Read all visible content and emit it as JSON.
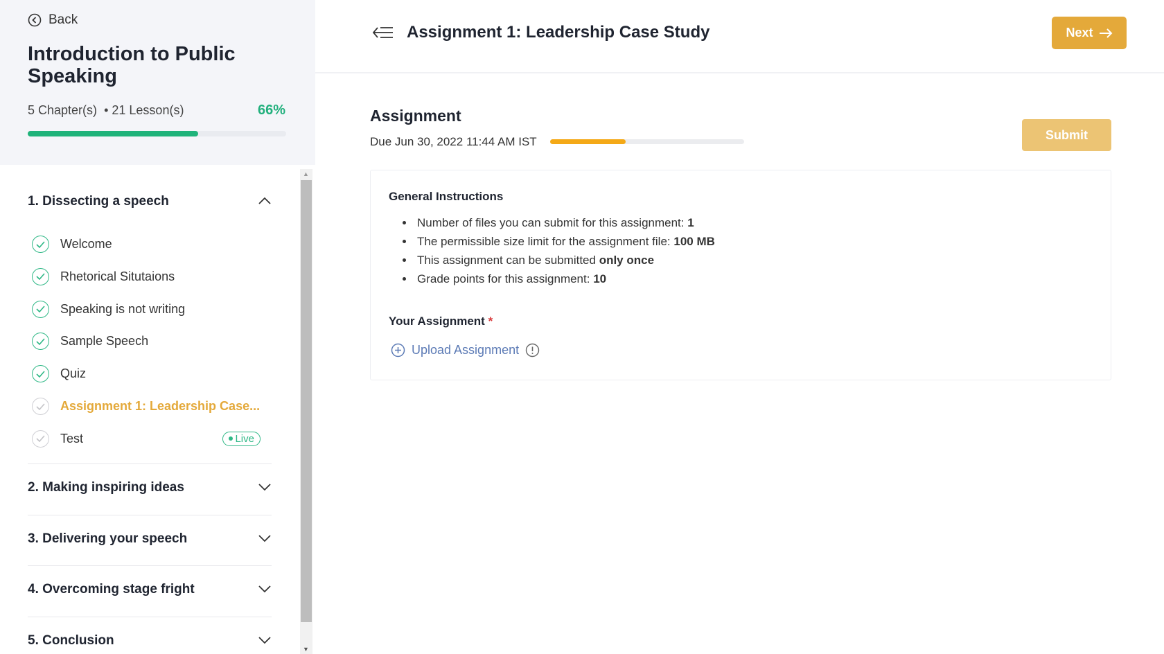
{
  "sidebar": {
    "back_label": "Back",
    "course_title": "Introduction to Public Speaking",
    "chapters_count": "5 Chapter(s)",
    "separator": "•",
    "lessons_count": "21 Lesson(s)",
    "progress_label": "66%",
    "progress_percent": 66,
    "chapters": [
      {
        "title": "1. Dissecting a speech",
        "expanded": true,
        "lessons": [
          {
            "label": "Welcome",
            "completed": true
          },
          {
            "label": "Rhetorical Situtaions",
            "completed": true
          },
          {
            "label": "Speaking is not writing",
            "completed": true
          },
          {
            "label": "Sample Speech",
            "completed": true
          },
          {
            "label": "Quiz",
            "completed": true
          },
          {
            "label": "Assignment 1: Leadership Case...",
            "completed": false,
            "active": true
          },
          {
            "label": "Test",
            "completed": false,
            "badge": "Live"
          }
        ]
      },
      {
        "title": "2. Making inspiring ideas",
        "expanded": false
      },
      {
        "title": "3. Delivering your speech",
        "expanded": false
      },
      {
        "title": "4. Overcoming stage fright",
        "expanded": false
      },
      {
        "title": "5. Conclusion",
        "expanded": false
      }
    ]
  },
  "header": {
    "title": "Assignment 1: Leadership Case Study",
    "next_label": "Next"
  },
  "assignment": {
    "heading": "Assignment",
    "due": "Due Jun 30, 2022 11:44 AM IST",
    "time_progress_percent": 39,
    "submit_label": "Submit",
    "instructions_title": "General Instructions",
    "instructions": [
      {
        "text": "Number of files you can submit for this assignment: ",
        "bold": "1"
      },
      {
        "text": "The permissible size limit for the assignment file: ",
        "bold": "100 MB"
      },
      {
        "text": "This assignment can be submitted ",
        "bold": "only once"
      },
      {
        "text": "Grade points for this assignment: ",
        "bold": "10"
      }
    ],
    "your_assignment_label": "Your Assignment",
    "required_mark": "*",
    "upload_label": "Upload Assignment"
  },
  "colors": {
    "accent": "#e4a93a",
    "success": "#1fb37a",
    "link": "#5b7ab5"
  }
}
